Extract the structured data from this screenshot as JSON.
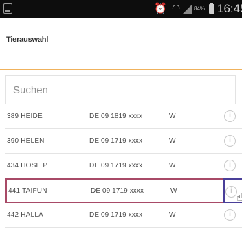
{
  "status_bar": {
    "battery": "84%",
    "time": "16:45",
    "icons": [
      "screenshot-icon",
      "alarm-icon",
      "wifi-icon",
      "signal-icon",
      "battery-icon"
    ]
  },
  "app": {
    "title": "Tierauswahl"
  },
  "search": {
    "placeholder": "Suchen",
    "value": ""
  },
  "colors": {
    "accent": "#f0b25c",
    "selected_border": "#a84a67",
    "highlight_box": "#4a3f99"
  },
  "list": {
    "rows": [
      {
        "name": "389 HEIDE",
        "de_number": "DE 09 1819 xxxx",
        "sex": "W"
      },
      {
        "name": "390 HELEN",
        "de_number": "DE 09 1719 xxxx",
        "sex": "W"
      },
      {
        "name": "434 HOSE P",
        "de_number": "DE 09 1719 xxxx",
        "sex": "W"
      },
      {
        "name": "441 TAIFUN",
        "de_number": "DE 09 1719 xxxx",
        "sex": "W",
        "selected": true
      },
      {
        "name": "442 HALLA",
        "de_number": "DE 09 1719 xxxx",
        "sex": "W"
      }
    ]
  }
}
